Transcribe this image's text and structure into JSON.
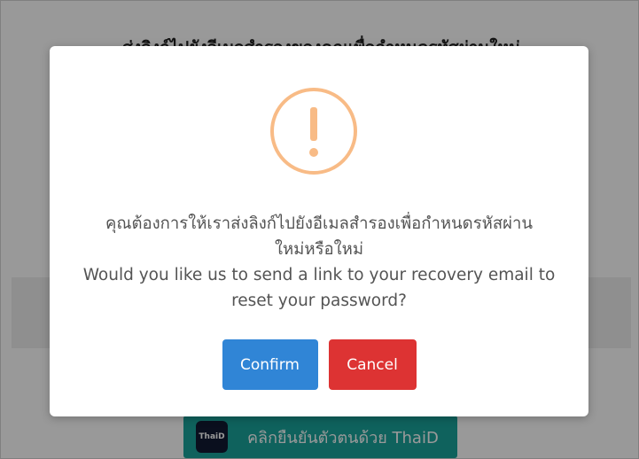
{
  "background": {
    "heading": "ส่งลิงก์ไปยังอีเมลสำรองของคุณเพื่อกำหนดรหัสผ่านใหม่",
    "thaid_button": {
      "logo_text": "ThaiD",
      "label": "คลิกยืนยันตัวตนด้วย ThaiD",
      "color": "#1aa39c"
    }
  },
  "dialog": {
    "icon": "warning-exclamation-icon",
    "icon_color": "#f8bb86",
    "message_th_line1": "คุณต้องการให้เราส่งลิงก์ไปยังอีเมลสำรองเพื่อกำหนดรหัสผ่าน",
    "message_th_line2": "ใหม่หรือใหม่",
    "message_en_line1": "Would you like us to send a link to your recovery email to",
    "message_en_line2": "reset your password?",
    "confirm_label": "Confirm",
    "cancel_label": "Cancel",
    "confirm_color": "#3085d6",
    "cancel_color": "#dd3333"
  }
}
